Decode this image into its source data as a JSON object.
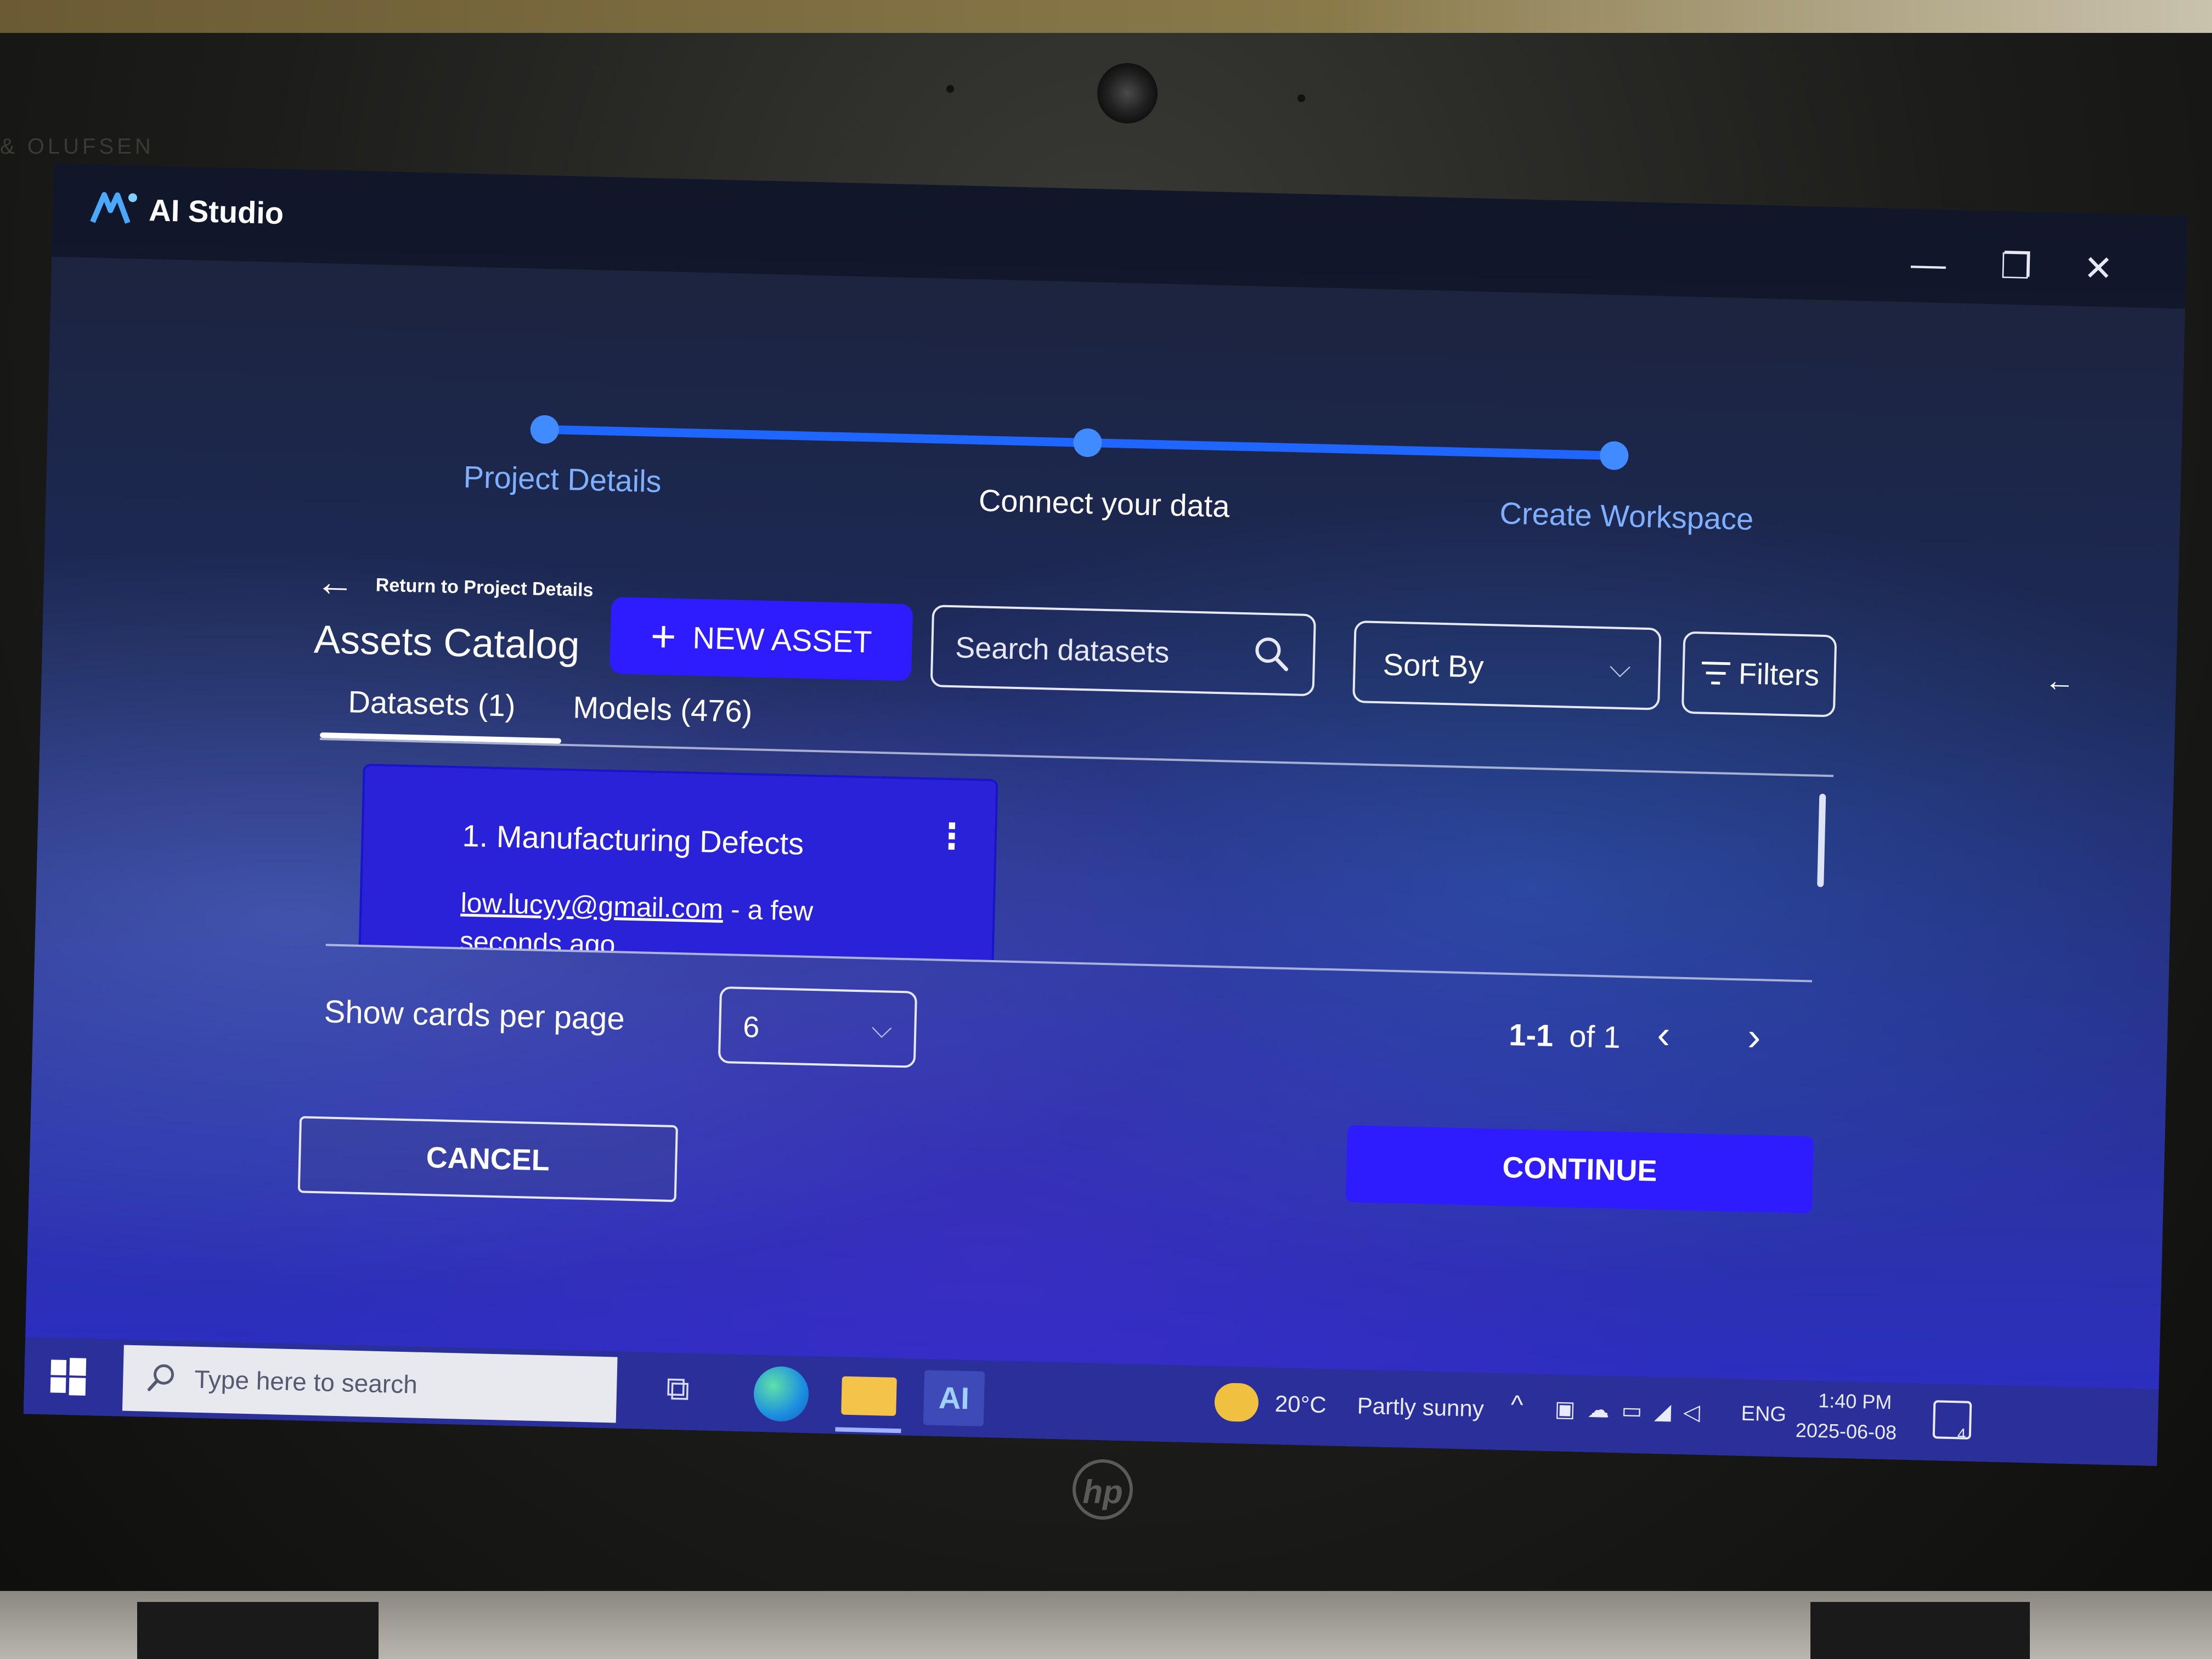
{
  "window": {
    "app_title": "AI Studio",
    "logo_text": "AI",
    "controls": {
      "minimize": "—",
      "maximize": "❐",
      "close": "✕"
    }
  },
  "stepper": {
    "steps": [
      {
        "label": "Project Details",
        "state": "done"
      },
      {
        "label": "Connect your data",
        "state": "current"
      },
      {
        "label": "Create Workspace",
        "state": "upcoming"
      }
    ],
    "accent_color": "#1f66ff"
  },
  "header": {
    "back_icon": "arrow-left-icon",
    "back_glyph": "←",
    "back_label": "Return to Project Details",
    "title": "Assets Catalog",
    "new_asset_glyph": "+",
    "new_asset_label": "NEW ASSET",
    "search": {
      "placeholder": "Search datasets",
      "value": ""
    },
    "sort_label": "Sort By",
    "sort_chevron": "⌵",
    "filters_label": "Filters"
  },
  "tabs": [
    {
      "label": "Datasets (1)",
      "active": true
    },
    {
      "label": "Models (476)",
      "active": false
    }
  ],
  "cards": [
    {
      "title": "1. Manufacturing Defects",
      "email": "low.lucyy@gmail.com",
      "time_suffix": "- a few seconds ago",
      "menu_glyph": "⋮"
    }
  ],
  "pagination": {
    "per_page_label": "Show cards per page",
    "per_page_value": "6",
    "per_page_chevron": "⌵",
    "range": "1-1",
    "of_total": "of 1",
    "prev_glyph": "‹",
    "next_glyph": "›"
  },
  "footer": {
    "cancel_label": "CANCEL",
    "continue_label": "CONTINUE",
    "side_arrow_glyph": "←"
  },
  "taskbar": {
    "search_placeholder": "Type here to search",
    "taskview_glyph": "⧉",
    "aistudio_glyph": "AI",
    "weather_temp": "20°C",
    "weather_desc": "Partly sunny",
    "tray_chevron": "^",
    "tray_icons": "▣☁▭◢◁",
    "language": "ENG",
    "time": "1:40 PM",
    "date": "2025-06-08",
    "notification_count": "4"
  },
  "device": {
    "brand_logo": "hp",
    "bezel_text": "& OLUFSEN"
  },
  "colors": {
    "primary_button": "#2e1cff",
    "screen_background": "#1d2a5a",
    "text": "#ffffff"
  }
}
